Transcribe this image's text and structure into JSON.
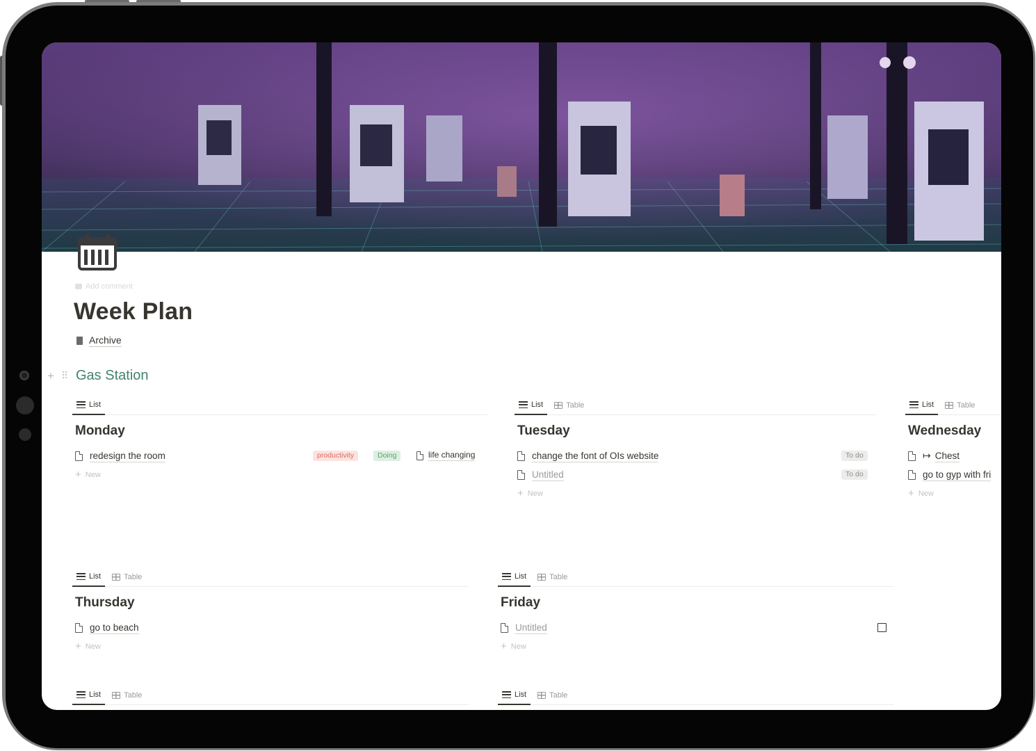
{
  "page": {
    "title": "Week Plan",
    "add_comment": "Add comment",
    "icon": "calendar-icon",
    "archive_label": "Archive"
  },
  "section": {
    "heading": "Gas Station"
  },
  "view_tabs": {
    "list": "List",
    "table": "Table"
  },
  "new_label": "New",
  "boards": {
    "monday": {
      "title": "Monday",
      "items": [
        {
          "name": "redesign the room",
          "tags": [
            "productivity",
            "Doing"
          ],
          "relation": "life changing"
        }
      ]
    },
    "tuesday": {
      "title": "Tuesday",
      "items": [
        {
          "name": "change the font of OIs website",
          "status": "To do"
        },
        {
          "name": "Untitled",
          "status": "To do"
        }
      ]
    },
    "wednesday": {
      "title": "Wednesday",
      "items": [
        {
          "name": "Chest"
        },
        {
          "name": "go to gyp with fri"
        }
      ]
    },
    "thursday": {
      "title": "Thursday",
      "items": [
        {
          "name": "go to beach"
        }
      ]
    },
    "friday": {
      "title": "Friday",
      "items": [
        {
          "name": "Untitled",
          "checked": false
        }
      ]
    }
  },
  "colors": {
    "heading_green": "#44836a",
    "tag_red_bg": "#fde3e0",
    "tag_green_bg": "#dcefe0",
    "tag_gray_bg": "#ececeb",
    "text": "#37352f"
  }
}
